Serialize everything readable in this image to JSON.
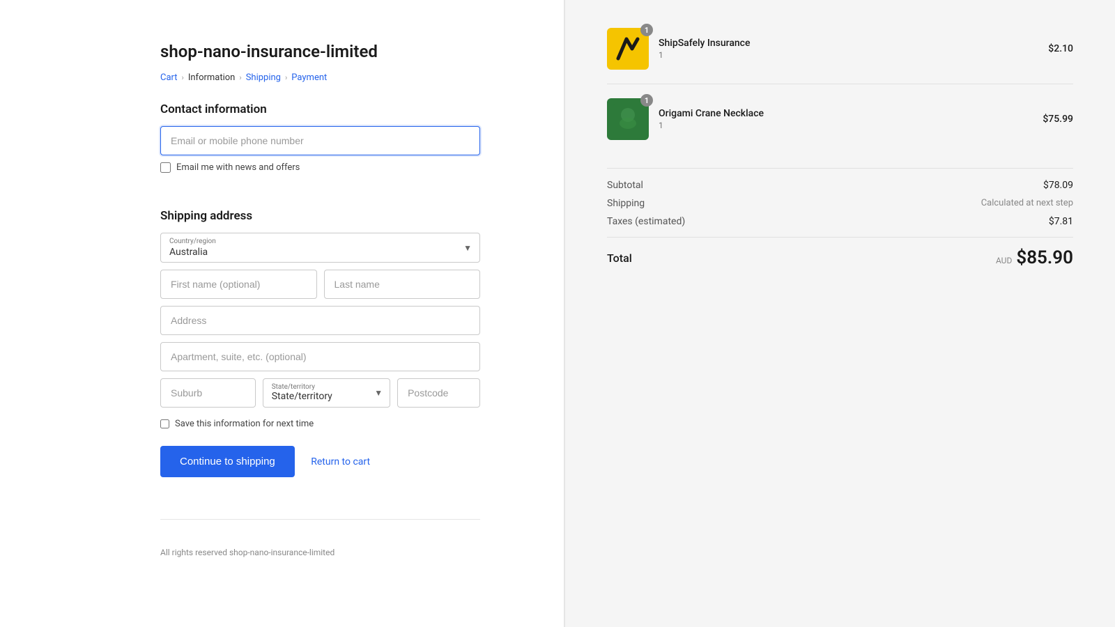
{
  "store": {
    "name": "shop-nano-insurance-limited",
    "footer": "All rights reserved shop-nano-insurance-limited"
  },
  "breadcrumb": {
    "items": [
      {
        "label": "Cart",
        "active": false
      },
      {
        "label": "Information",
        "active": true
      },
      {
        "label": "Shipping",
        "active": false
      },
      {
        "label": "Payment",
        "active": false
      }
    ]
  },
  "contact": {
    "section_title": "Contact information",
    "email_placeholder": "Email or mobile phone number",
    "email_checkbox_label": "Email me with news and offers"
  },
  "shipping": {
    "section_title": "Shipping address",
    "country_label": "Country/region",
    "country_value": "Australia",
    "first_name_placeholder": "First name (optional)",
    "last_name_placeholder": "Last name",
    "address_placeholder": "Address",
    "apt_placeholder": "Apartment, suite, etc. (optional)",
    "suburb_placeholder": "Suburb",
    "state_label": "State/territory",
    "state_value": "State/territory",
    "postcode_placeholder": "Postcode",
    "save_label": "Save this information for next time"
  },
  "actions": {
    "continue_label": "Continue to shipping",
    "return_label": "Return to cart"
  },
  "order": {
    "items": [
      {
        "id": "shipsafely",
        "name": "ShipSafely Insurance",
        "qty": "1",
        "price": "$2.10",
        "type": "shipsafely"
      },
      {
        "id": "origami",
        "name": "Origami Crane Necklace",
        "qty": "1",
        "price": "$75.99",
        "type": "origami"
      }
    ],
    "subtotal_label": "Subtotal",
    "subtotal_value": "$78.09",
    "shipping_label": "Shipping",
    "shipping_value": "Calculated at next step",
    "taxes_label": "Taxes (estimated)",
    "taxes_value": "$7.81",
    "total_label": "Total",
    "total_currency": "AUD",
    "total_value": "$85.90"
  }
}
